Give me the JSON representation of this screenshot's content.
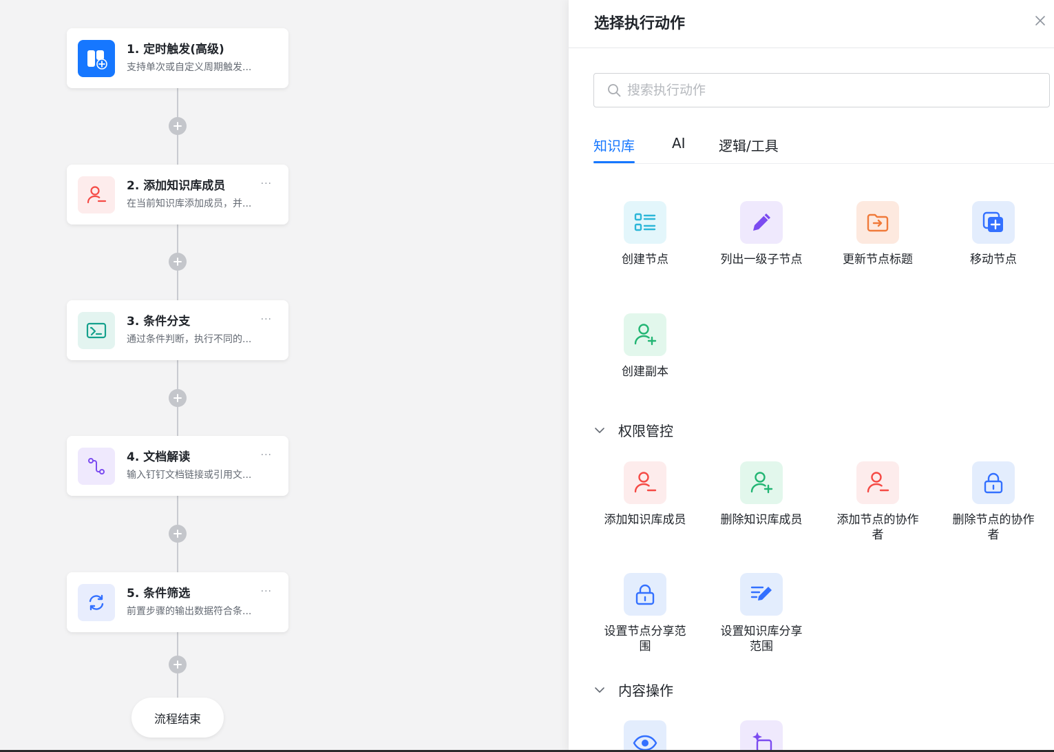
{
  "flow": {
    "nodes": [
      {
        "title": "1. 定时触发(高级)",
        "desc": "支持单次或自定义周期触发...",
        "icon": "calendar-clock-icon",
        "color": "#1677ff"
      },
      {
        "title": "2. 添加知识库成员",
        "desc": "在当前知识库添加成员，并...",
        "icon": "user-minus-icon",
        "color": "#f54a45"
      },
      {
        "title": "3. 条件分支",
        "desc": "通过条件判断，执行不同的...",
        "icon": "terminal-icon",
        "color": "#14a08c"
      },
      {
        "title": "4. 文档解读",
        "desc": "输入钉钉文档链接或引用文...",
        "icon": "route-icon",
        "color": "#7b4bf0"
      },
      {
        "title": "5. 条件筛选",
        "desc": "前置步骤的输出数据符合条...",
        "icon": "refresh-icon",
        "color": "#3370ff"
      }
    ],
    "more_label": "···",
    "end_label": "流程结束"
  },
  "panel": {
    "title": "选择执行动作",
    "search_placeholder": "搜索执行动作",
    "tabs": [
      "知识库",
      "AI",
      "逻辑/工具"
    ],
    "active_tab": 0,
    "group1": [
      {
        "label": "创建节点",
        "icon": "list-icon"
      },
      {
        "label": "列出一级子节点",
        "icon": "pencil-icon"
      },
      {
        "label": "更新节点标题",
        "icon": "folder-arrow-icon"
      },
      {
        "label": "移动节点",
        "icon": "copy-plus-icon"
      },
      {
        "label": "创建副本",
        "icon": "user-plus-icon"
      }
    ],
    "section_permissions": "权限管控",
    "group2": [
      {
        "label": "添加知识库成员",
        "icon": "user-minus-icon"
      },
      {
        "label": "删除知识库成员",
        "icon": "user-plus-icon"
      },
      {
        "label": "添加节点的协作者",
        "icon": "user-minus-icon"
      },
      {
        "label": "删除节点的协作者",
        "icon": "lock-icon"
      },
      {
        "label": "设置节点分享范围",
        "icon": "lock-icon"
      },
      {
        "label": "设置知识库分享范围",
        "icon": "edit-lines-icon"
      }
    ],
    "section_content": "内容操作",
    "group3": [
      {
        "label": "",
        "icon": "eye-icon"
      },
      {
        "label": "",
        "icon": "sparkle-icon"
      }
    ]
  }
}
